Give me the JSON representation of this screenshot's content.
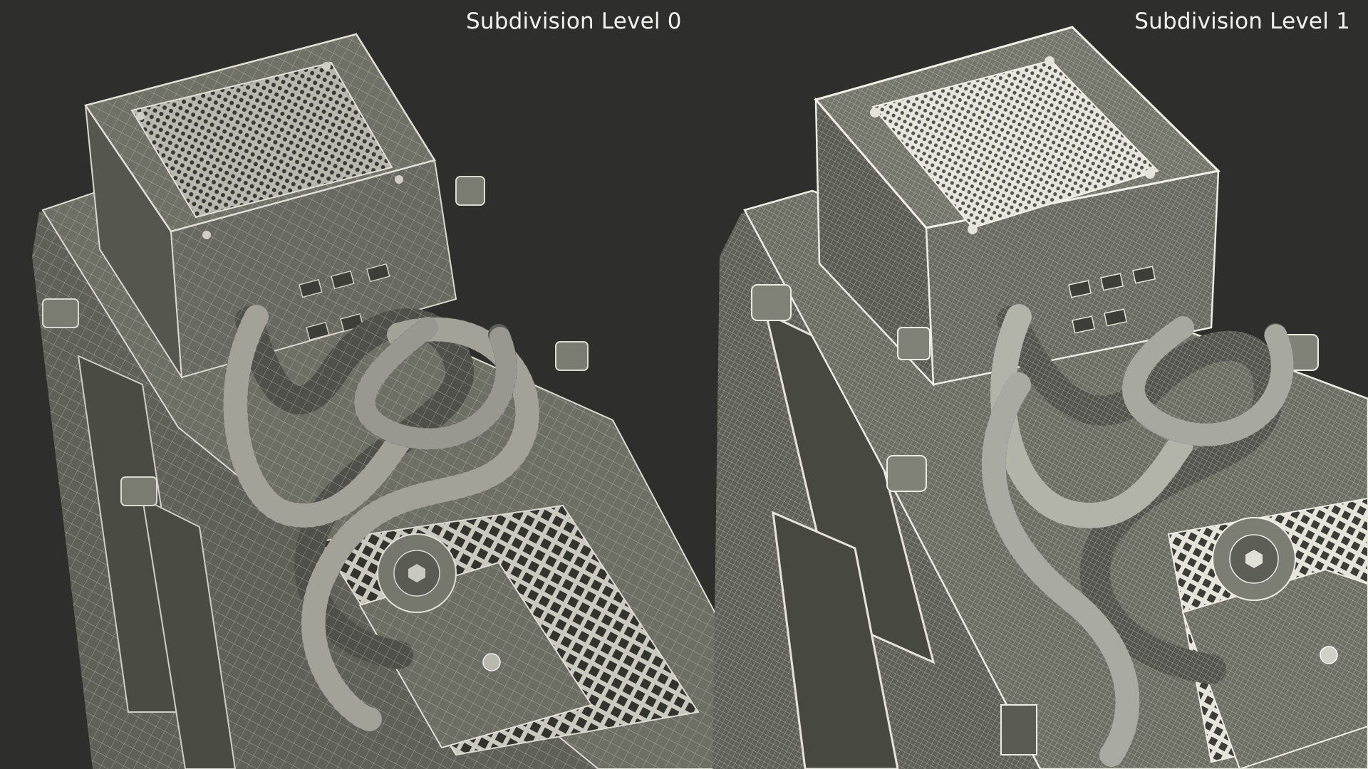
{
  "labels": {
    "left": "Subdivision Level 0",
    "right": "Subdivision Level 1"
  },
  "colors": {
    "background": "#2e2e2c",
    "model_fill": "#6d6e64",
    "model_dark": "#4a4b43",
    "wire_level0": "#d9d9cf",
    "wire_level1": "#eceee4",
    "label_text": "#f2f2ee"
  },
  "models": [
    {
      "id": "level-0",
      "subdivision_level": 0
    },
    {
      "id": "level-1",
      "subdivision_level": 1
    }
  ]
}
